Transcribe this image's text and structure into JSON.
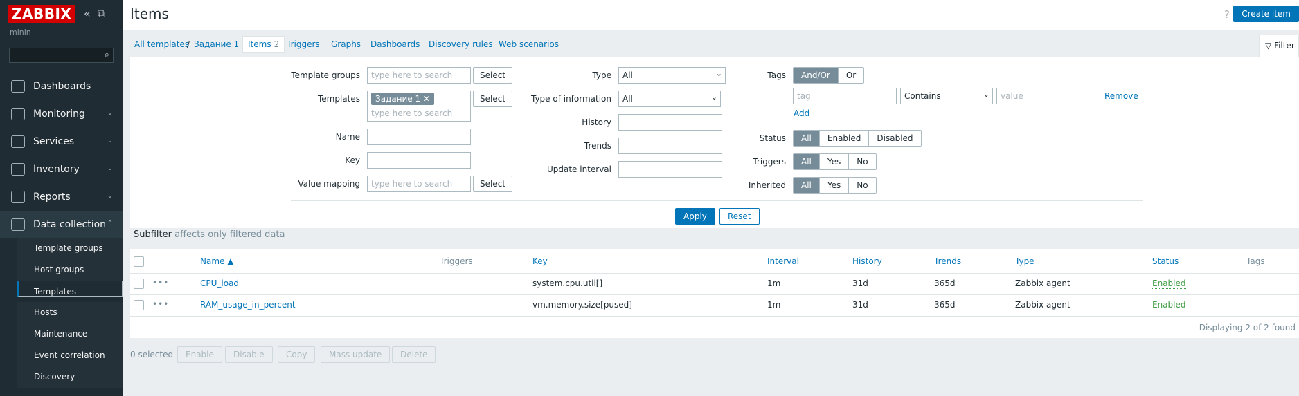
{
  "sidebar": {
    "logo": "ZABBIX",
    "user": "minin",
    "nav": [
      {
        "label": "Dashboards",
        "icon": "dashboards-icon",
        "chevron": ""
      },
      {
        "label": "Monitoring",
        "icon": "monitoring-icon",
        "chevron": "⌄"
      },
      {
        "label": "Services",
        "icon": "services-icon",
        "chevron": "⌄"
      },
      {
        "label": "Inventory",
        "icon": "inventory-icon",
        "chevron": "⌄"
      },
      {
        "label": "Reports",
        "icon": "reports-icon",
        "chevron": "⌄"
      },
      {
        "label": "Data collection",
        "icon": "data-collection-icon",
        "chevron": "⌃"
      }
    ],
    "subnav": [
      "Template groups",
      "Host groups",
      "Templates",
      "Hosts",
      "Maintenance",
      "Event correlation",
      "Discovery"
    ]
  },
  "header": {
    "title": "Items",
    "help": "?",
    "create_label": "Create item"
  },
  "breadcrumbs": {
    "all_templates": "All templates",
    "sep": "/",
    "template": "Задание 1",
    "items": "Items",
    "items_count": "2",
    "triggers": "Triggers",
    "graphs": "Graphs",
    "dashboards": "Dashboards",
    "discovery": "Discovery rules",
    "web": "Web scenarios",
    "filter": "Filter"
  },
  "filter": {
    "template_groups_label": "Template groups",
    "templates_label": "Templates",
    "name_label": "Name",
    "key_label": "Key",
    "value_mapping_label": "Value mapping",
    "search_placeholder": "type here to search",
    "select_label": "Select",
    "template_chip": "Задание 1",
    "type_label": "Type",
    "type_value": "All",
    "type_info_label": "Type of information",
    "type_info_value": "All",
    "history_label": "History",
    "trends_label": "Trends",
    "update_label": "Update interval",
    "tags_label": "Tags",
    "and_or": "And/Or",
    "or": "Or",
    "tag_placeholder": "tag",
    "contains": "Contains",
    "value_placeholder": "value",
    "remove": "Remove",
    "add": "Add",
    "status_label": "Status",
    "status_options": [
      "All",
      "Enabled",
      "Disabled"
    ],
    "triggers_label": "Triggers",
    "inherited_label": "Inherited",
    "yn_options": [
      "All",
      "Yes",
      "No"
    ],
    "apply": "Apply",
    "reset": "Reset"
  },
  "subfilter": {
    "title": "Subfilter",
    "note": "affects only filtered data"
  },
  "table": {
    "headers": {
      "name": "Name ▲",
      "triggers": "Triggers",
      "key": "Key",
      "interval": "Interval",
      "history": "History",
      "trends": "Trends",
      "type": "Type",
      "status": "Status",
      "tags": "Tags"
    },
    "rows": [
      {
        "name": "CPU_load",
        "key": "system.cpu.util[]",
        "interval": "1m",
        "history": "31d",
        "trends": "365d",
        "type": "Zabbix agent",
        "status": "Enabled"
      },
      {
        "name": "RAM_usage_in_percent",
        "key": "vm.memory.size[pused]",
        "interval": "1m",
        "history": "31d",
        "trends": "365d",
        "type": "Zabbix agent",
        "status": "Enabled"
      }
    ],
    "displaying": "Displaying 2 of 2 found"
  },
  "actions": {
    "selected": "0 selected",
    "buttons": [
      "Enable",
      "Disable",
      "Copy",
      "Mass update",
      "Delete"
    ]
  }
}
